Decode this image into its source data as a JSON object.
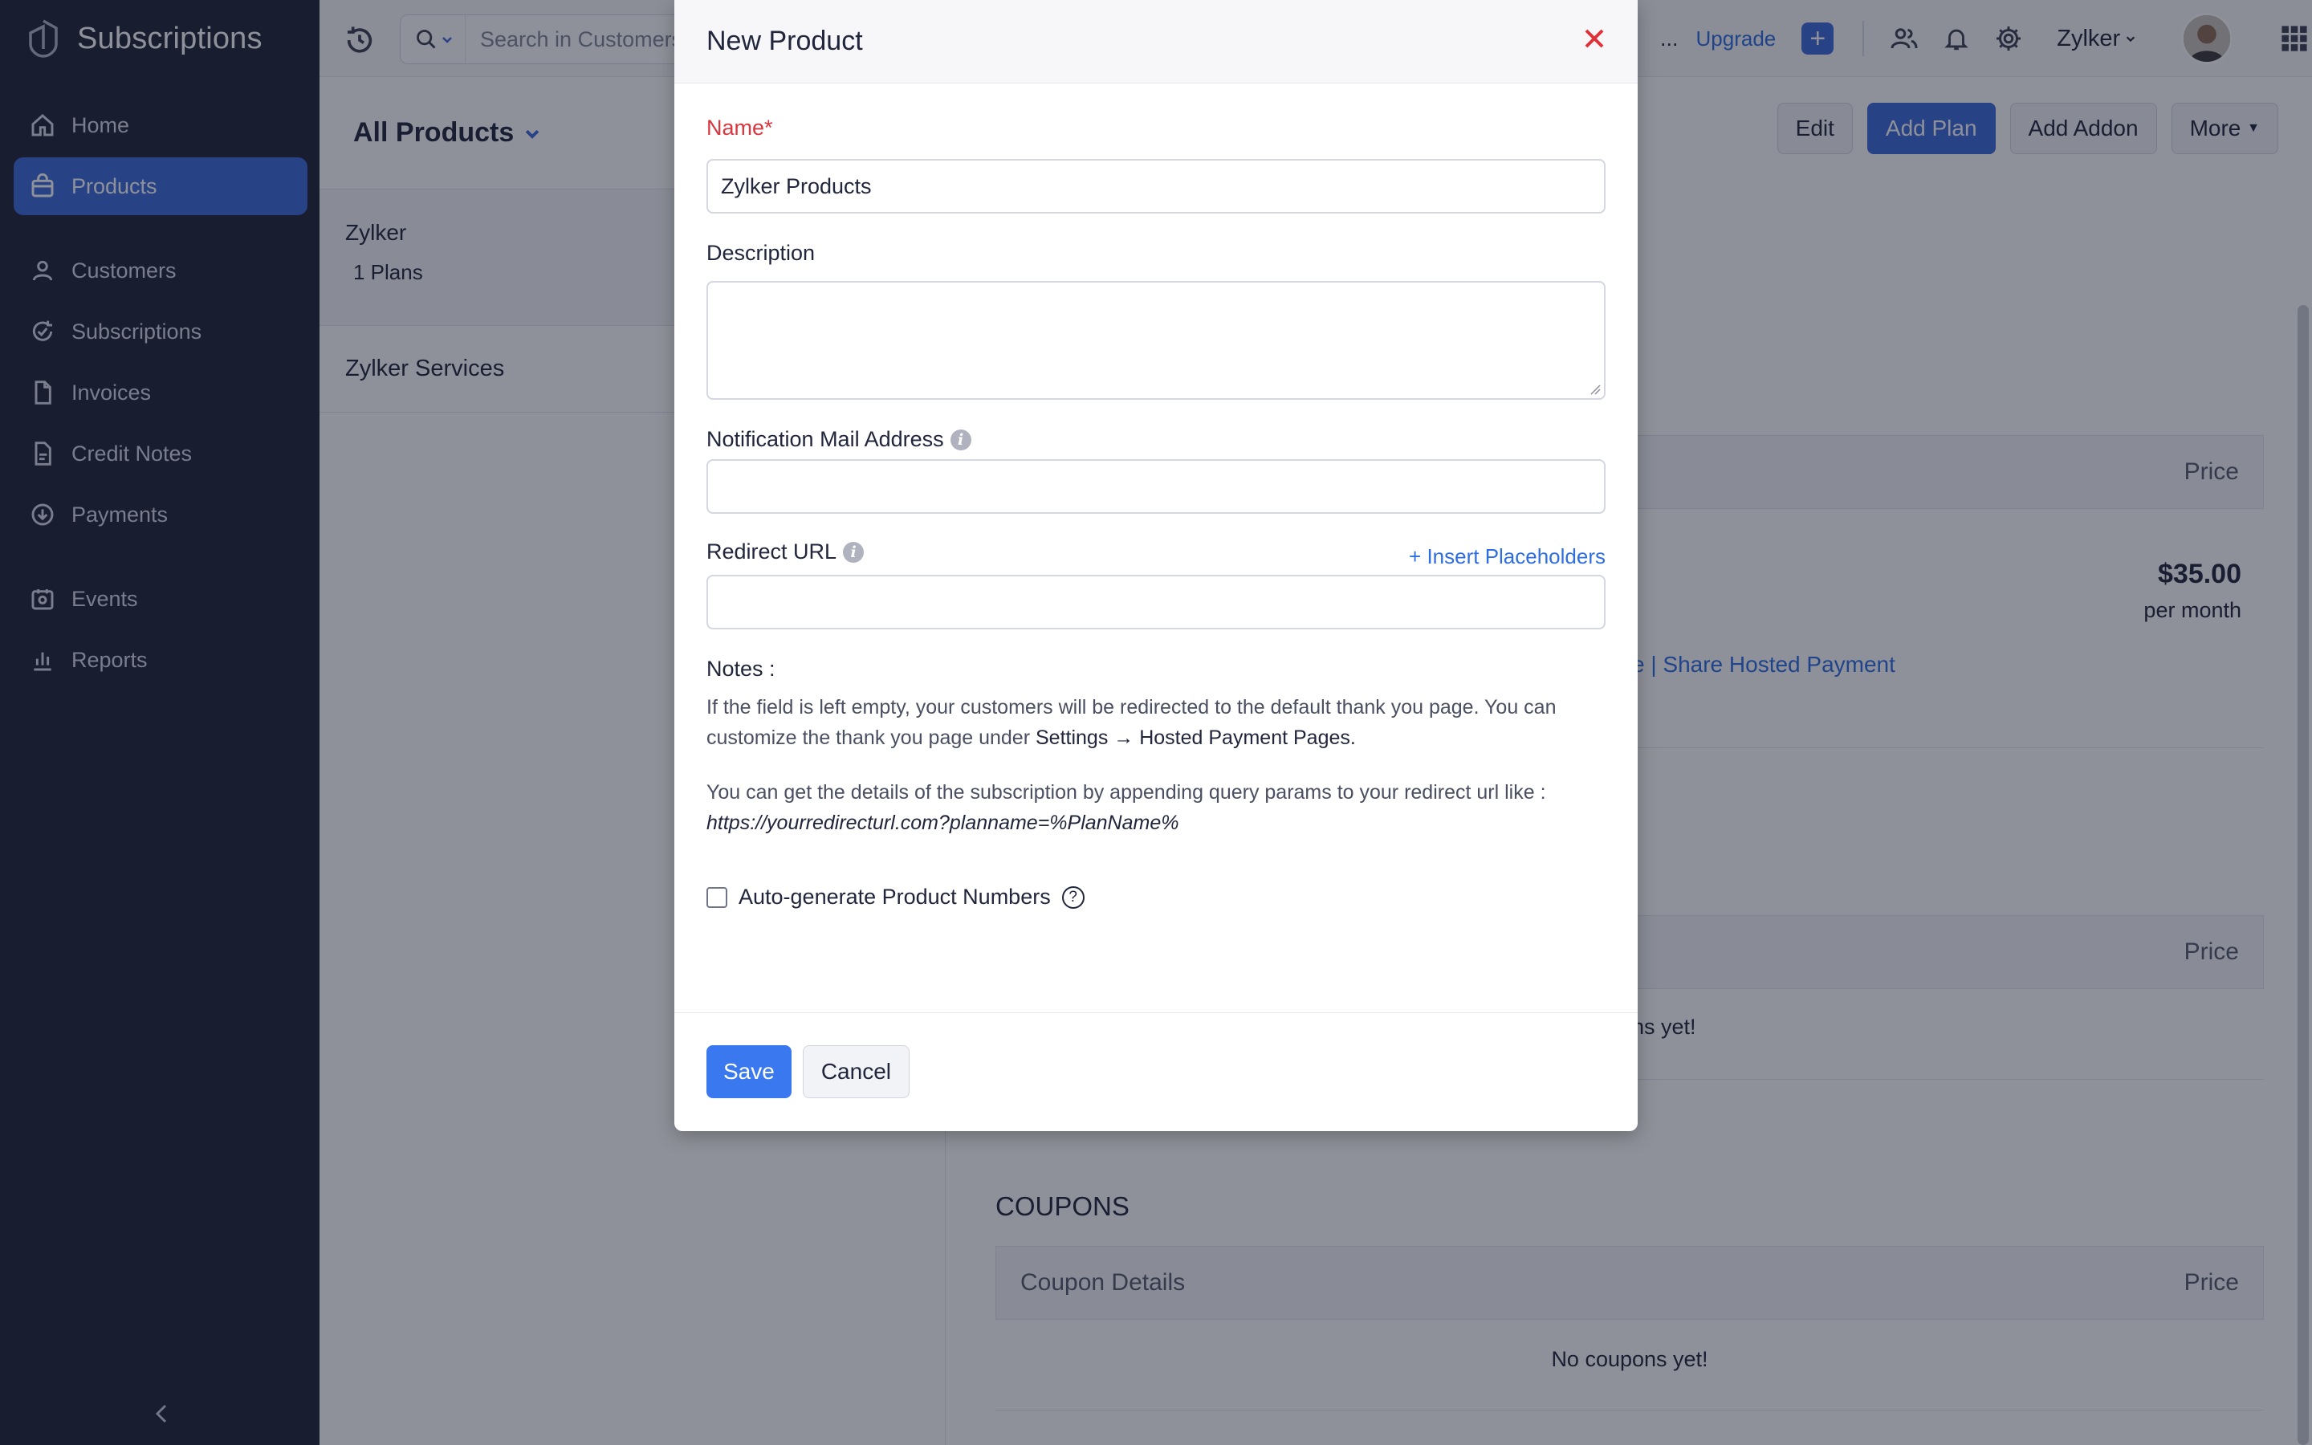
{
  "sidebar": {
    "app_title": "Subscriptions",
    "items": [
      {
        "label": "Home"
      },
      {
        "label": "Products"
      },
      {
        "label": "Customers"
      },
      {
        "label": "Subscriptions"
      },
      {
        "label": "Invoices"
      },
      {
        "label": "Credit Notes"
      },
      {
        "label": "Payments"
      },
      {
        "label": "Events"
      },
      {
        "label": "Reports"
      }
    ]
  },
  "topbar": {
    "search_placeholder": "Search in Customers",
    "ellipsis": "...",
    "upgrade": "Upgrade",
    "org": "Zylker"
  },
  "list": {
    "title": "All Products",
    "rows": [
      {
        "name": "Zylker",
        "sub": "1 Plans"
      },
      {
        "name": "Zylker Services"
      }
    ]
  },
  "detail": {
    "actions": {
      "edit": "Edit",
      "add_plan": "Add Plan",
      "add_addon": "Add Addon",
      "more": "More"
    },
    "plans_price_header": "Price",
    "plan_price": "$35.00",
    "plan_period": "per month",
    "plan_links": "e | Share Hosted Payment",
    "addons_price_header": "Price",
    "addons_empty": "ns yet!",
    "coupons_title": "COUPONS",
    "coupons_header": "Coupon Details",
    "coupons_price_header": "Price",
    "coupons_empty": "No coupons yet!"
  },
  "modal": {
    "title": "New Product",
    "name_label": "Name*",
    "name_value": "Zylker Products",
    "description_label": "Description",
    "notification_label": "Notification Mail Address",
    "redirect_label": "Redirect URL",
    "insert_placeholders": "+ Insert Placeholders",
    "notes_title": "Notes :",
    "note1_a": "If the field is left empty, your customers will be redirected to the default thank you page. You can customize the thank you page under ",
    "note1_b": "Settings → Hosted Payment Pages.",
    "note2_a": "You can get the details of the subscription by appending query params to your redirect url like :",
    "note2_b": "https://yourredirecturl.com?planname=%PlanName%",
    "autogen_label": "Auto-generate Product Numbers",
    "save": "Save",
    "cancel": "Cancel"
  },
  "colors": {
    "sidebar_bg": "#1f2438",
    "accent": "#3b6ad8",
    "required": "#d9363e",
    "link": "#2e6ee0"
  }
}
